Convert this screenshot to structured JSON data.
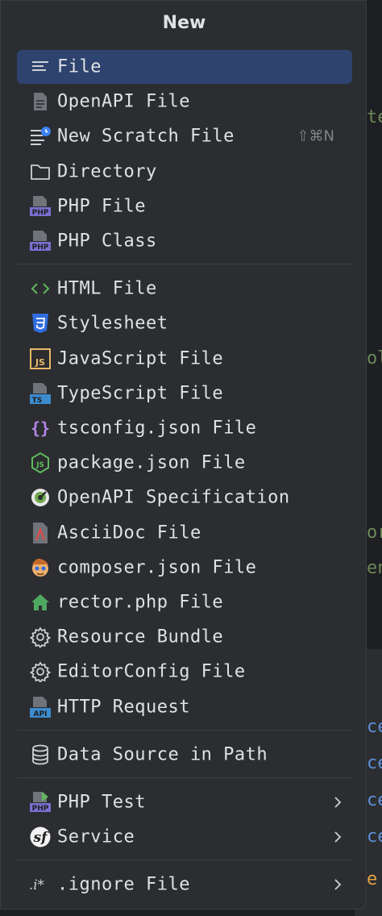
{
  "popup": {
    "title": "New",
    "groups": [
      [
        {
          "label": "File",
          "icon": "text-file-icon",
          "selected": true
        },
        {
          "label": "OpenAPI File",
          "icon": "openapi-file-icon"
        },
        {
          "label": "New Scratch File",
          "icon": "scratch-file-icon",
          "shortcut": "⇧⌘N"
        },
        {
          "label": "Directory",
          "icon": "folder-icon"
        },
        {
          "label": "PHP File",
          "icon": "php-file-icon"
        },
        {
          "label": "PHP Class",
          "icon": "php-class-icon"
        }
      ],
      [
        {
          "label": "HTML File",
          "icon": "html-icon"
        },
        {
          "label": "Stylesheet",
          "icon": "css-icon"
        },
        {
          "label": "JavaScript File",
          "icon": "javascript-icon"
        },
        {
          "label": "TypeScript File",
          "icon": "typescript-icon"
        },
        {
          "label": "tsconfig.json File",
          "icon": "tsconfig-icon"
        },
        {
          "label": "package.json File",
          "icon": "nodejs-icon"
        },
        {
          "label": "OpenAPI Specification",
          "icon": "openapi-spec-icon"
        },
        {
          "label": "AsciiDoc File",
          "icon": "asciidoc-icon"
        },
        {
          "label": "composer.json File",
          "icon": "composer-icon"
        },
        {
          "label": "rector.php File",
          "icon": "rector-house-icon"
        },
        {
          "label": "Resource Bundle",
          "icon": "gear-icon"
        },
        {
          "label": "EditorConfig File",
          "icon": "gear-icon"
        },
        {
          "label": "HTTP Request",
          "icon": "api-icon"
        }
      ],
      [
        {
          "label": "Data Source in Path",
          "icon": "database-icon"
        }
      ],
      [
        {
          "label": "PHP Test",
          "icon": "php-test-icon",
          "submenu": true
        },
        {
          "label": "Service",
          "icon": "symfony-icon",
          "submenu": true
        }
      ],
      [
        {
          "label": ".ignore File",
          "icon": "ignore-icon",
          "submenu": true
        }
      ]
    ]
  },
  "editor": {
    "fragments": [
      {
        "text": "te",
        "color": "#6a8759"
      },
      {
        "text": "ol",
        "color": "#6a8759"
      },
      {
        "text": "or",
        "color": "#6a8759"
      },
      {
        "text": "en",
        "color": "#6a8759"
      },
      {
        "text": "ce",
        "color": "#5c8fd6"
      },
      {
        "text": "ce",
        "color": "#5c8fd6"
      },
      {
        "text": "ce",
        "color": "#5c8fd6"
      },
      {
        "text": "ce",
        "color": "#5c8fd6"
      },
      {
        "text": "e",
        "color": "#e0a040"
      }
    ]
  },
  "colors": {
    "popup_bg": "#2b2d30",
    "selection": "#2e436e",
    "text": "#dfe1e5",
    "separator": "#3d3f44"
  }
}
